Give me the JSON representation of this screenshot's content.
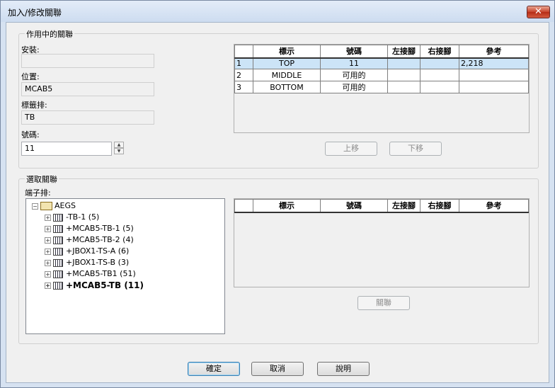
{
  "window": {
    "title": "加入/修改關聯",
    "close_glyph": "✕"
  },
  "active": {
    "group_label": "作用中的關聯",
    "install_label": "安裝:",
    "install_value": "",
    "location_label": "位置:",
    "location_value": "MCAB5",
    "strip_label": "標籤排:",
    "strip_value": "TB",
    "number_label": "號碼:",
    "number_value": "11",
    "columns": [
      "標示",
      "號碼",
      "左接腳",
      "右接腳",
      "參考"
    ],
    "rows": [
      {
        "n": "1",
        "tag": "TOP",
        "num": "11",
        "left": "",
        "right": "",
        "ref": "2,218"
      },
      {
        "n": "2",
        "tag": "MIDDLE",
        "num": "可用的",
        "left": "",
        "right": "",
        "ref": ""
      },
      {
        "n": "3",
        "tag": "BOTTOM",
        "num": "可用的",
        "left": "",
        "right": "",
        "ref": ""
      }
    ],
    "move_up_label": "上移",
    "move_down_label": "下移"
  },
  "select": {
    "group_label": "選取關聯",
    "strip_label": "端子排:",
    "tree_root": "AEGS",
    "tree_items": [
      "-TB-1 (5)",
      "+MCAB5-TB-1 (5)",
      "+MCAB5-TB-2 (4)",
      "+JBOX1-TS-A (6)",
      "+JBOX1-TS-B (3)",
      "+MCAB5-TB1 (51)",
      "+MCAB5-TB (11)"
    ],
    "columns": [
      "標示",
      "號碼",
      "左接腳",
      "右接腳",
      "參考"
    ],
    "link_label": "關聯"
  },
  "footer": {
    "ok_label": "確定",
    "cancel_label": "取消",
    "help_label": "說明"
  }
}
